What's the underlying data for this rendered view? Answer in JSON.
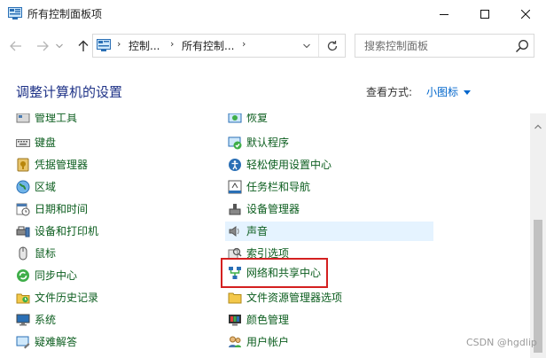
{
  "window": {
    "title": "所有控制面板项"
  },
  "nav": {
    "breadcrumbs": [
      "控制...",
      "所有控制..."
    ],
    "search_placeholder": "搜索控制面板"
  },
  "header": {
    "title": "调整计算机的设置",
    "view_by_label": "查看方式:",
    "view_by_value": "小图标"
  },
  "items_left": [
    {
      "label": "管理工具",
      "icon": "admin-tools-icon"
    },
    {
      "label": "键盘",
      "icon": "keyboard-icon"
    },
    {
      "label": "凭据管理器",
      "icon": "credential-manager-icon"
    },
    {
      "label": "区域",
      "icon": "region-icon"
    },
    {
      "label": "日期和时间",
      "icon": "date-time-icon"
    },
    {
      "label": "设备和打印机",
      "icon": "devices-printers-icon"
    },
    {
      "label": "鼠标",
      "icon": "mouse-icon"
    },
    {
      "label": "同步中心",
      "icon": "sync-center-icon"
    },
    {
      "label": "文件历史记录",
      "icon": "file-history-icon"
    },
    {
      "label": "系统",
      "icon": "system-icon"
    },
    {
      "label": "疑难解答",
      "icon": "troubleshooting-icon"
    }
  ],
  "items_right": [
    {
      "label": "恢复",
      "icon": "recovery-icon"
    },
    {
      "label": "默认程序",
      "icon": "default-programs-icon"
    },
    {
      "label": "轻松使用设置中心",
      "icon": "ease-of-access-icon"
    },
    {
      "label": "任务栏和导航",
      "icon": "taskbar-navigation-icon"
    },
    {
      "label": "设备管理器",
      "icon": "device-manager-icon"
    },
    {
      "label": "声音",
      "icon": "sound-icon"
    },
    {
      "label": "索引选项",
      "icon": "indexing-options-icon"
    },
    {
      "label": "网络和共享中心",
      "icon": "network-sharing-icon"
    },
    {
      "label": "文件资源管理器选项",
      "icon": "file-explorer-options-icon"
    },
    {
      "label": "颜色管理",
      "icon": "color-management-icon"
    },
    {
      "label": "用户帐户",
      "icon": "user-accounts-icon"
    }
  ],
  "watermark": "CSDN @hgdlip",
  "colors": {
    "link_green": "#0b5d1e",
    "title_blue": "#1e3287",
    "highlight_red": "#d42020",
    "hover_blue": "#e5f3ff"
  }
}
